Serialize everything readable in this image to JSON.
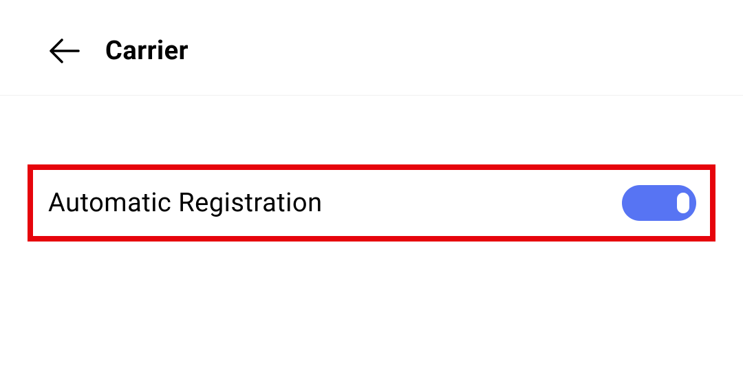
{
  "header": {
    "title": "Carrier"
  },
  "settings": {
    "auto_registration": {
      "label": "Automatic Registration",
      "enabled": true
    }
  },
  "colors": {
    "highlight_border": "#e6040c",
    "toggle_on": "#5774f3"
  }
}
